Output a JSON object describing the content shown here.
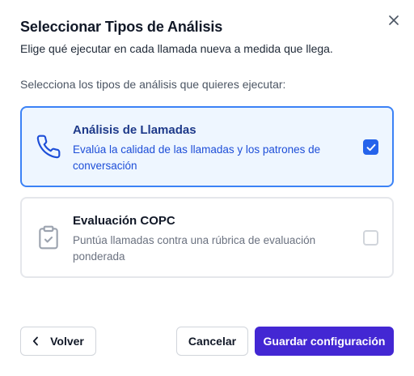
{
  "dialog": {
    "title": "Seleccionar Tipos de Análisis",
    "subtitle": "Elige qué ejecutar en cada llamada nueva a medida que llega.",
    "section_label": "Selecciona los tipos de análisis que quieres ejecutar:",
    "close_icon": "close-icon"
  },
  "options": [
    {
      "title": "Análisis de Llamadas",
      "description": "Evalúa la calidad de las llamadas y los patrones de conversación",
      "icon": "phone-icon",
      "checked": true
    },
    {
      "title": "Evaluación COPC",
      "description": "Puntúa llamadas contra una rúbrica de evaluación ponderada",
      "icon": "clipboard-check-icon",
      "checked": false
    }
  ],
  "footer": {
    "back_label": "Volver",
    "cancel_label": "Cancelar",
    "save_label": "Guardar configuración"
  },
  "colors": {
    "primary": "#4327d3",
    "selected_border": "#3b82f6",
    "selected_bg": "#eef6ff",
    "checkbox_checked": "#2563eb"
  }
}
